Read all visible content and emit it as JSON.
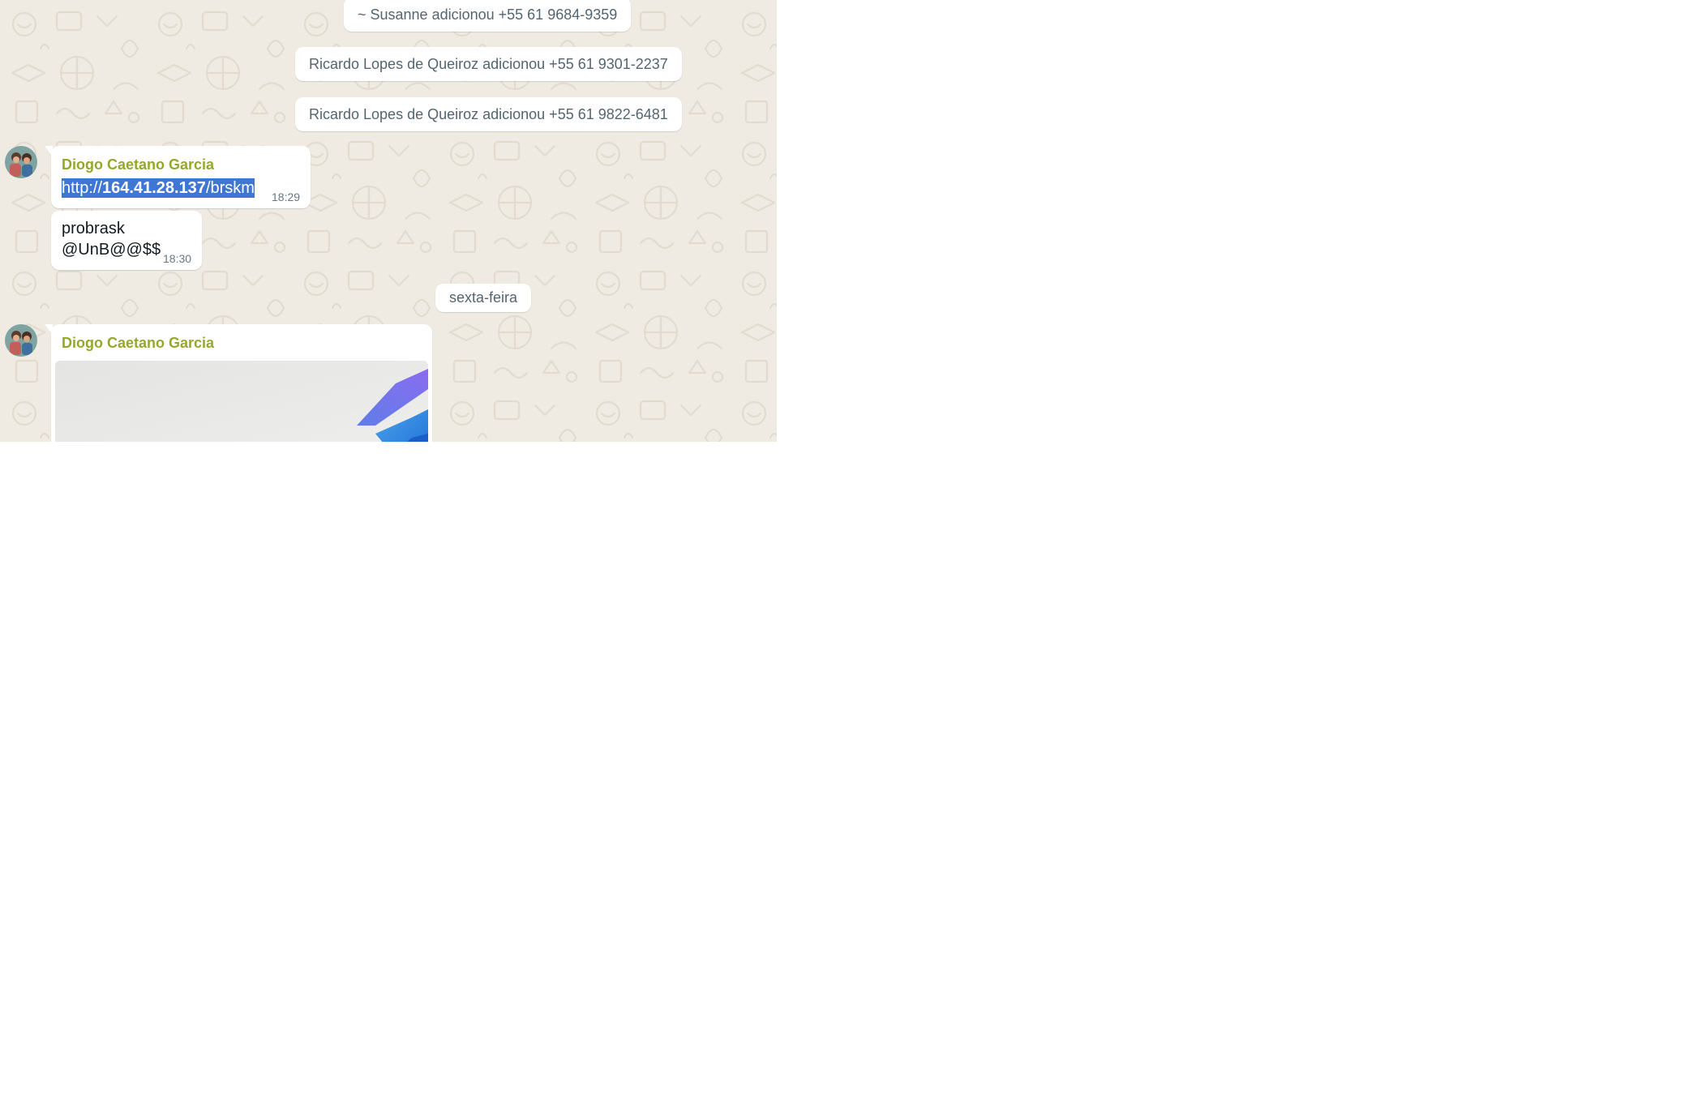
{
  "system_messages": [
    "~ Susanne adicionou +55 61 9684-9359",
    "Ricardo Lopes de Queiroz adicionou +55 61 9301-2237",
    "Ricardo Lopes de Queiroz adicionou +55 61 9822-6481"
  ],
  "messages": [
    {
      "sender": "Diogo Caetano Garcia",
      "link_prefix": "http://",
      "link_bold": "164.41.28.137",
      "link_suffix": "/brskm",
      "time": "18:29"
    },
    {
      "line1": "probrask",
      "line2": "@UnB@@$$",
      "time": "18:30"
    }
  ],
  "date_divider": "sexta-feira",
  "image_message": {
    "sender": "Diogo Caetano Garcia"
  },
  "colors": {
    "chat_background": "#efeae2",
    "sender_name": "#95a829",
    "link_highlight": "#3f76d4"
  },
  "icons": {
    "avatar": "user-avatar-photo",
    "image": "attached-image-preview"
  }
}
